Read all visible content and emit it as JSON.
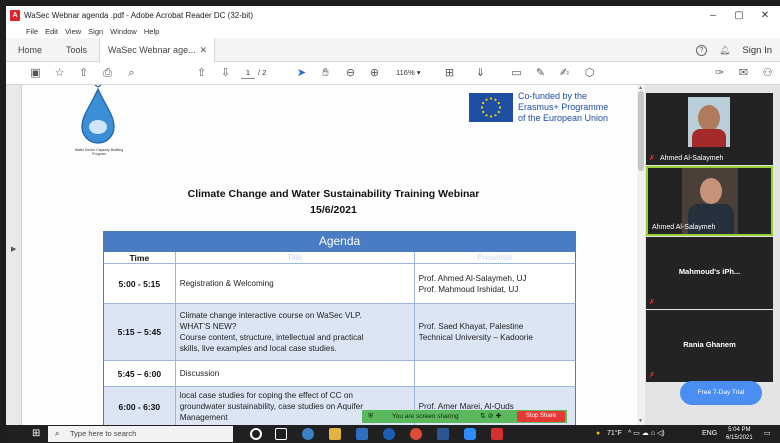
{
  "window": {
    "title": "WaSec Webnar agenda .pdf - Adobe Acrobat Reader DC (32-bit)",
    "minimize": "–",
    "maximize": "▢",
    "close": "✕"
  },
  "menu": [
    "File",
    "Edit",
    "View",
    "Sign",
    "Window",
    "Help"
  ],
  "tabs": {
    "home": "Home",
    "tools": "Tools",
    "doc": "WaSec Webnar age...",
    "close": "✕",
    "sign_in": "Sign In"
  },
  "toolbar": {
    "page_current": "1",
    "page_total": "/ 2",
    "zoom": "116%"
  },
  "document": {
    "eu_text": [
      "Co-funded by the",
      "Erasmus+ Programme",
      "of the European Union"
    ],
    "logo_caption": "Water Sector Capacity Building Program",
    "title": "Climate Change and Water Sustainability Training Webinar",
    "date": "15/6/2021",
    "agenda_title": "Agenda",
    "headers": {
      "time": "Time",
      "title": "Title",
      "presenter": "Presenter"
    },
    "rows": [
      {
        "time": "5:00 - 5:15",
        "title": [
          "Registration & Welcoming"
        ],
        "presenter": [
          "Prof. Ahmed Al-Salaymeh, UJ",
          "Prof. Mahmoud Irshidat, UJ"
        ]
      },
      {
        "time": "5:15 – 5:45",
        "title": [
          "Climate change interactive course on WaSec VLP.",
          "WHAT’S NEW?",
          "Course content, structure, intellectual and practical",
          "skills, live examples and local case studies."
        ],
        "presenter": [
          "Prof. Saed Khayat, Palestine",
          "Technical University – Kadoorie"
        ]
      },
      {
        "time": "5:45 – 6:00",
        "title": [
          "Discussion"
        ],
        "presenter": [
          ""
        ]
      },
      {
        "time": "6:00 - 6:30",
        "title": [
          "local case studies for coping the effect of CC on",
          "groundwater sustainability, case studies on Aquifer",
          "Management"
        ],
        "presenter": [
          "Prof. Amer Marei, Al-Quds",
          ""
        ]
      }
    ]
  },
  "video": {
    "tile1_name": "Ahmed Al-Salaymeh",
    "tile2_name": "Ahmed Al-Salaymeh",
    "tile3_name": "Mahmoud's iPh...",
    "tile4_name": "Rania Ghanem",
    "trial_button": "Free 7-Day Trial"
  },
  "share_bar": {
    "message": "You are screen sharing",
    "stop": "Stop Share"
  },
  "taskbar": {
    "search_placeholder": "Type here to search",
    "weather": "71°F",
    "lang": "ENG",
    "time": "5:04 PM",
    "date": "6/15/2021"
  }
}
